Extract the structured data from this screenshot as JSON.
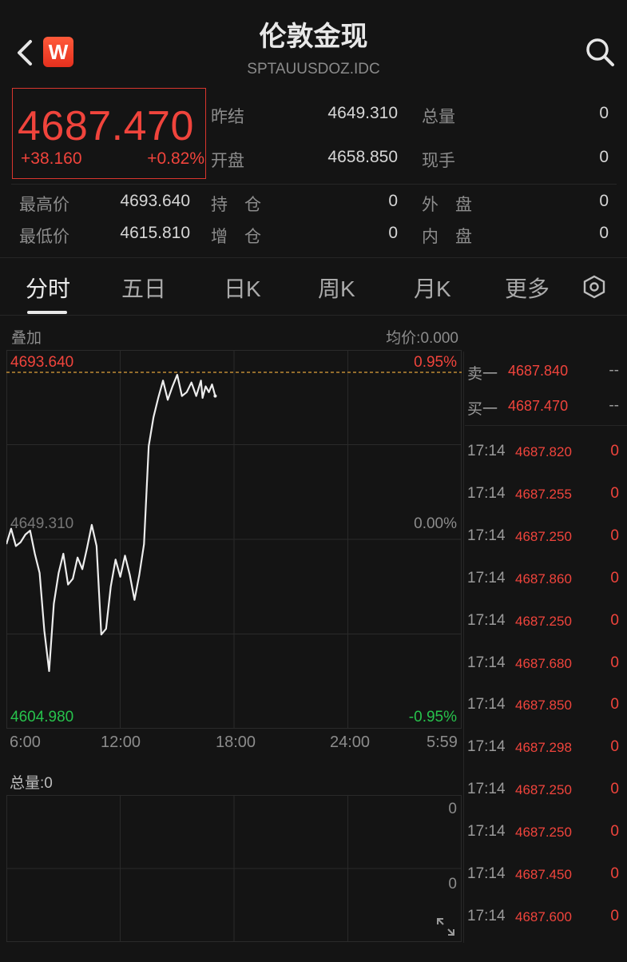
{
  "header": {
    "title": "伦敦金现",
    "subtitle": "SPTAUUSDOZ.IDC",
    "logo_letter": "W"
  },
  "quote": {
    "price": "4687.470",
    "change": "+38.160",
    "change_pct": "+0.82%",
    "stats": [
      {
        "label": "昨结",
        "value": "4649.310"
      },
      {
        "label": "总量",
        "value": "0"
      },
      {
        "label": "开盘",
        "value": "4658.850"
      },
      {
        "label": "现手",
        "value": "0"
      },
      {
        "label": "最高价",
        "value": "4693.640"
      },
      {
        "label": "持　仓",
        "value": "0"
      },
      {
        "label": "外　盘",
        "value": "0"
      },
      {
        "label": "最低价",
        "value": "4615.810"
      },
      {
        "label": "增　仓",
        "value": "0"
      },
      {
        "label": "内　盘",
        "value": "0"
      }
    ]
  },
  "tabs": [
    "分时",
    "五日",
    "日K",
    "周K",
    "月K",
    "更多"
  ],
  "active_tab": 0,
  "chart_header": {
    "overlay": "叠加",
    "avg_price": "均价:0.000"
  },
  "chart_data": {
    "type": "line",
    "y_axis_left": {
      "top": "4693.640",
      "mid": "4649.310",
      "bottom": "4604.980"
    },
    "y_axis_right": {
      "top": "0.95%",
      "mid": "0.00%",
      "bottom": "-0.95%"
    },
    "ylim": [
      4604.98,
      4693.64
    ],
    "x_ticks": [
      "6:00",
      "12:00",
      "18:00",
      "24:00",
      "5:59"
    ],
    "x_range_minutes": [
      0,
      1439
    ],
    "series": [
      {
        "x": [
          0,
          15,
          30,
          45,
          60,
          75,
          90,
          105,
          120,
          135,
          150,
          165,
          180,
          195,
          210,
          225,
          240,
          255,
          270,
          285,
          300,
          315,
          330,
          345,
          360,
          375,
          390,
          405,
          420,
          435,
          450,
          465,
          480,
          495,
          510,
          525,
          540,
          555,
          570,
          585,
          600,
          615,
          620,
          630,
          640,
          650,
          660
        ],
        "values": [
          4649.0,
          4653.0,
          4648.5,
          4649.5,
          4651.5,
          4652.5,
          4646.5,
          4641.5,
          4626.5,
          4616.0,
          4633.5,
          4641.5,
          4646.5,
          4638.5,
          4640.0,
          4645.5,
          4642.5,
          4648.0,
          4654.0,
          4648.5,
          4625.5,
          4627.0,
          4638.0,
          4645.0,
          4640.5,
          4646.0,
          4641.0,
          4634.5,
          4641.0,
          4649.0,
          4674.5,
          4682.0,
          4687.0,
          4691.5,
          4686.5,
          4690.0,
          4693.0,
          4687.5,
          4688.5,
          4691.0,
          4687.5,
          4691.5,
          4687.0,
          4690.0,
          4688.5,
          4690.5,
          4687.5
        ]
      }
    ],
    "volume": {
      "label": "总量:0",
      "axis_values": [
        "0",
        "0"
      ]
    }
  },
  "orderbook": {
    "asks": [
      {
        "label": "卖一",
        "price": "4687.840",
        "qty": "--"
      }
    ],
    "bids": [
      {
        "label": "买一",
        "price": "4687.470",
        "qty": "--"
      }
    ]
  },
  "ticks": [
    {
      "time": "17:14",
      "price": "4687.820",
      "qty": "0"
    },
    {
      "time": "17:14",
      "price": "4687.255",
      "qty": "0"
    },
    {
      "time": "17:14",
      "price": "4687.250",
      "qty": "0"
    },
    {
      "time": "17:14",
      "price": "4687.860",
      "qty": "0"
    },
    {
      "time": "17:14",
      "price": "4687.250",
      "qty": "0"
    },
    {
      "time": "17:14",
      "price": "4687.680",
      "qty": "0"
    },
    {
      "time": "17:14",
      "price": "4687.850",
      "qty": "0"
    },
    {
      "time": "17:14",
      "price": "4687.298",
      "qty": "0"
    },
    {
      "time": "17:14",
      "price": "4687.250",
      "qty": "0"
    },
    {
      "time": "17:14",
      "price": "4687.250",
      "qty": "0"
    },
    {
      "time": "17:14",
      "price": "4687.450",
      "qty": "0"
    },
    {
      "time": "17:14",
      "price": "4687.600",
      "qty": "0"
    }
  ],
  "colors": {
    "up": "#f0443c",
    "down": "#27c24c",
    "line": "#ededed",
    "grid": "#2a2a2a",
    "high_line": "#e0a23a"
  }
}
